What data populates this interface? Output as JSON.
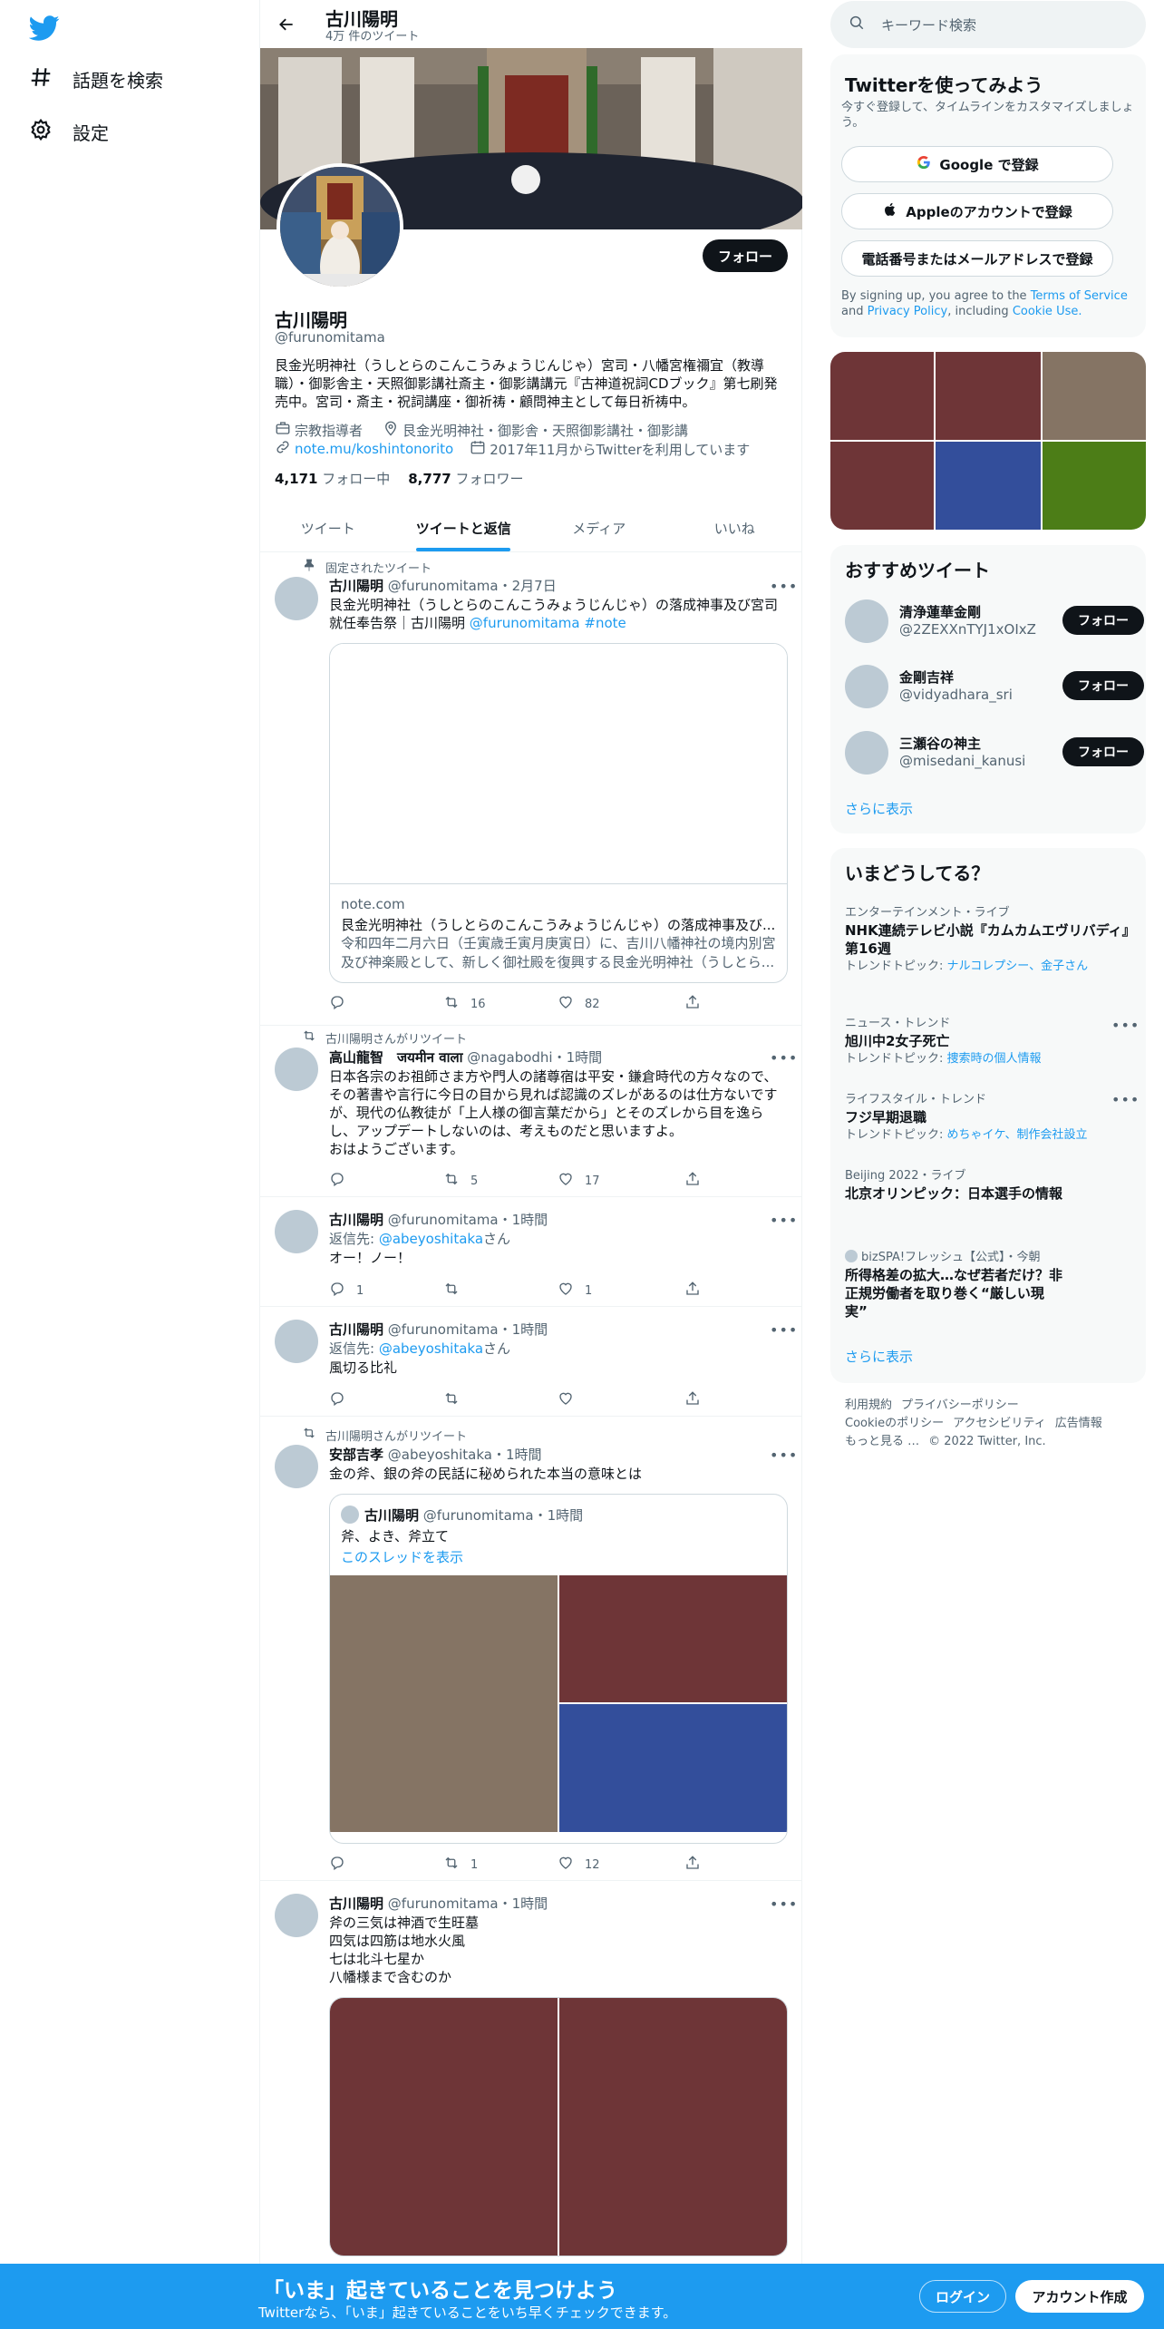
{
  "nav": {
    "explore_label": "話題を検索",
    "settings_label": "設定"
  },
  "header": {
    "title": "古川陽明",
    "tweet_count": "4万 件のツイート"
  },
  "profile": {
    "name": "古川陽明",
    "handle": "@furunomitama",
    "follow_label": "フォロー",
    "bio": "艮金光明神社（うしとらのこんこうみょうじんじゃ）宮司・八幡宮権禰宜（教導職）・御影舎主・天照御影講社斎主・御影講講元『古神道祝詞CDブック』第七刷発売中。宮司・斎主・祝詞講座・御祈祷・顧問神主として毎日祈祷中。",
    "category": "宗教指導者",
    "location": "艮金光明神社・御影舎・天照御影講社・御影講",
    "url": "note.mu/koshintonorito",
    "joined": "2017年11月からTwitterを利用しています",
    "following_count": "4,171",
    "following_label": "フォロー中",
    "followers_count": "8,777",
    "followers_label": "フォロワー"
  },
  "tabs": [
    "ツイート",
    "ツイートと返信",
    "メディア",
    "いいね"
  ],
  "tweets": {
    "t1": {
      "pinned": "固定されたツイート",
      "name": "古川陽明",
      "handle": "@furunomitama",
      "time": "・2月7日",
      "text": "艮金光明神社（うしとらのこんこうみょうじんじゃ）の落成神事及び宮司就任奉告祭｜古川陽明",
      "mention": "@furunomitama",
      "hashtag": "#note",
      "card_domain": "note.com",
      "card_title": "艮金光明神社（うしとらのこんこうみょうじんじゃ）の落成神事及び...",
      "card_desc": "令和四年二月六日（壬寅歳壬寅月庚寅日）に、吉川八幡神社の境内別宮及び神楽殿として、新しく御社殿を復興する艮金光明神社（うしとら...",
      "retweets": "16",
      "likes": "82"
    },
    "t2": {
      "social": "古川陽明さんがリツイート",
      "name": "高山龍智　जयमीन वाला",
      "handle": "@nagabodhi",
      "time": "・1時間",
      "text": "日本各宗のお祖師さま方や門人の諸尊宿は平安・鎌倉時代の方々なので、その著書や言行に今日の目から見れば認識のズレがあるのは仕方ないですが、現代の仏教徒が「上人様の御言葉だから」とそのズレから目を逸らし、アップデートしないのは、考えものだと思いますよ。",
      "text2": "おはようございます。",
      "retweets": "5",
      "likes": "17"
    },
    "t3": {
      "name": "古川陽明",
      "handle": "@furunomitama",
      "time": "・1時間",
      "reply_prefix": "返信先:",
      "reply_to": "@abeyoshitaka",
      "reply_suffix": "さん",
      "text": "オー！ノー！",
      "replies": "1",
      "likes": "1"
    },
    "t4": {
      "name": "古川陽明",
      "handle": "@furunomitama",
      "time": "・1時間",
      "reply_prefix": "返信先:",
      "reply_to": "@abeyoshitaka",
      "reply_suffix": "さん",
      "text": "風切る比礼"
    },
    "t5": {
      "social": "古川陽明さんがリツイート",
      "name": "安部吉孝",
      "handle": "@abeyoshitaka",
      "time": "・1時間",
      "text": "金の斧、銀の斧の民話に秘められた本当の意味とは",
      "quote_name": "古川陽明",
      "quote_handle": "@furunomitama",
      "quote_time": "・1時間",
      "quote_text": "斧、よき、斧立て",
      "quote_link": "このスレッドを表示",
      "retweets": "1",
      "likes": "12"
    },
    "t6": {
      "name": "古川陽明",
      "handle": "@furunomitama",
      "time": "・1時間",
      "lines": [
        "斧の三気は神酒で生旺墓",
        "四気は四筋は地水火風",
        "七は北斗七星か",
        "八幡様まで含むのか"
      ]
    }
  },
  "right": {
    "search_placeholder": "キーワード検索",
    "signup_title": "Twitterを使ってみよう",
    "signup_sub": "今すぐ登録して、タイムラインをカスタマイズしましょう。",
    "google_label": "Google で登録",
    "apple_label": "Appleのアカウントで登録",
    "phone_label": "電話番号またはメールアドレスで登録",
    "terms_pre": "By signing up, you agree to the ",
    "terms_link": "Terms of Service",
    "terms_and": " and ",
    "privacy_link": "Privacy Policy",
    "terms_inc": ", including ",
    "cookie_link": "Cookie Use.",
    "recommend_title": "おすすめツイート",
    "recommend": [
      {
        "name": "清浄蓮華金剛",
        "handle": "@2ZEXXnTYJ1xOIxZ",
        "button": "フォロー"
      },
      {
        "name": "金剛吉祥",
        "handle": "@vidyadhara_sri",
        "button": "フォロー"
      },
      {
        "name": "三瀬谷の神主",
        "handle": "@misedani_kanusi",
        "button": "フォロー"
      }
    ],
    "show_more": "さらに表示",
    "trends_title": "いまどうしてる？",
    "trends": [
      {
        "cat": "エンターテインメント・ライブ",
        "title": "NHK連続テレビ小説『カムカムエヴリバディ』第16週",
        "topic_prefix": "トレンドトピック: ",
        "topic": "ナルコレプシー、金子さん"
      },
      {
        "cat": "ニュース・トレンド",
        "title": "旭川中2女子死亡",
        "topic_prefix": "トレンドトピック: ",
        "topic": "捜索時の個人情報"
      },
      {
        "cat": "ライフスタイル・トレンド",
        "title": "フジ早期退職",
        "topic_prefix": "トレンドトピック: ",
        "topic": "めちゃイケ、制作会社設立"
      },
      {
        "cat": "Beijing 2022・ライブ",
        "title": "北京オリンピック：日本選手の情報"
      },
      {
        "cat": "bizSPA!フレッシュ【公式】・今朝",
        "title": "所得格差の拡大…なぜ若者だけ？非正規労働者を取り巻く“厳しい現実”"
      }
    ],
    "trends_more": "さらに表示",
    "footer": [
      "利用規約",
      "プライバシーポリシー",
      "Cookieのポリシー",
      "アクセシビリティ",
      "広告情報",
      "もっと見る …",
      "© 2022 Twitter, Inc."
    ]
  },
  "bottombar": {
    "title": "「いま」起きていることを見つけよう",
    "sub": "Twitterなら、「いま」起きていることをいち早くチェックできます。",
    "login": "ログイン",
    "signup": "アカウント作成"
  },
  "colors": {
    "accent": "#1d9bf0",
    "tile_red": "#6e3537",
    "tile_blue": "#334e9b",
    "tile_taupe": "#857464",
    "tile_green": "#4c7d17"
  }
}
